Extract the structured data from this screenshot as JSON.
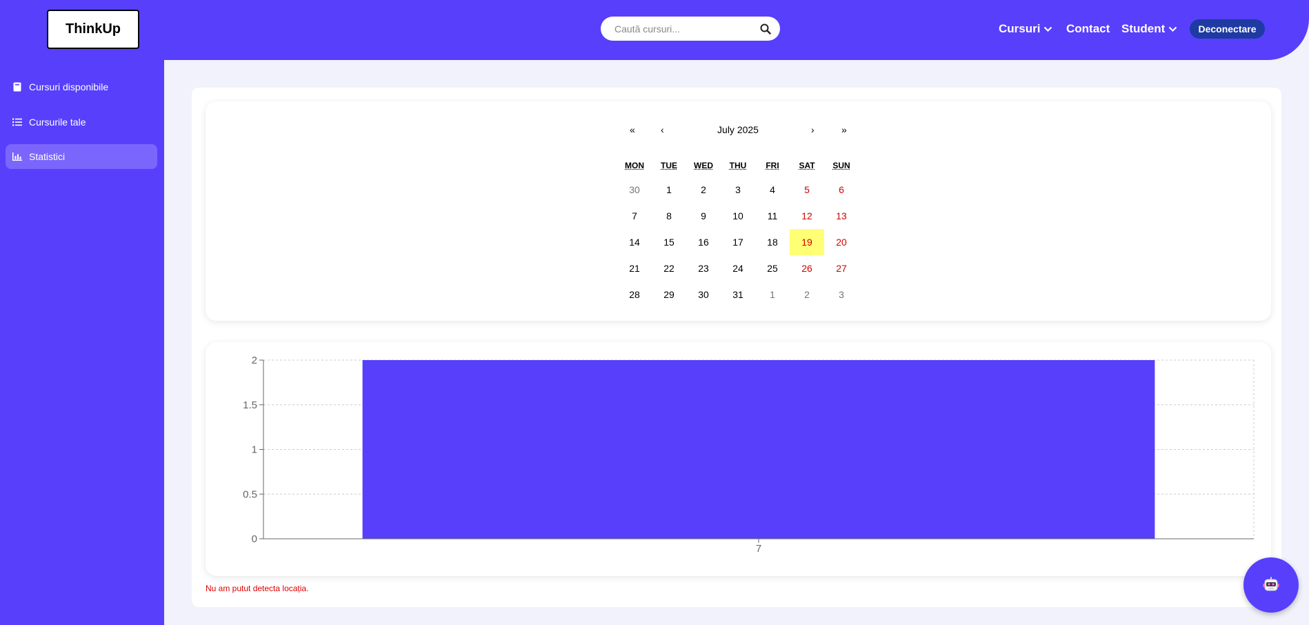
{
  "header": {
    "logo": "ThinkUp",
    "search_placeholder": "Caută cursuri...",
    "nav": {
      "courses": "Cursuri",
      "contact": "Contact",
      "student": "Student",
      "logout": "Deconectare"
    }
  },
  "sidebar": {
    "items": [
      {
        "label": "Cursuri disponibile",
        "icon": "book-icon"
      },
      {
        "label": "Cursurile tale",
        "icon": "list-icon"
      },
      {
        "label": "Statistici",
        "icon": "bar-chart-icon",
        "active": true
      }
    ]
  },
  "calendar": {
    "first_label": "«",
    "prev_label": "‹",
    "month_label": "July 2025",
    "next_label": "›",
    "last_label": "»",
    "weekdays": [
      "MON",
      "TUE",
      "WED",
      "THU",
      "FRI",
      "SAT",
      "SUN"
    ],
    "weeks": [
      [
        "30",
        "1",
        "2",
        "3",
        "4",
        "5",
        "6"
      ],
      [
        "7",
        "8",
        "9",
        "10",
        "11",
        "12",
        "13"
      ],
      [
        "14",
        "15",
        "16",
        "17",
        "18",
        "19",
        "20"
      ],
      [
        "21",
        "22",
        "23",
        "24",
        "25",
        "26",
        "27"
      ],
      [
        "28",
        "29",
        "30",
        "31",
        "1",
        "2",
        "3"
      ]
    ],
    "today": "19"
  },
  "chart_data": {
    "type": "bar",
    "categories": [
      "7"
    ],
    "values": [
      2
    ],
    "ylim": [
      0,
      2
    ],
    "yticks": [
      "0",
      "0.5",
      "1",
      "1.5",
      "2"
    ],
    "grid": true,
    "bar_color": "#573ffc",
    "title": "",
    "xlabel": "",
    "ylabel": ""
  },
  "status": {
    "error": "Nu am putut detecta locația."
  },
  "colors": {
    "primary": "#573ffc",
    "logout_button": "#1f3aa3",
    "today_highlight": "#ffff76",
    "weekend_text": "#d10000",
    "error_text": "#e00000"
  }
}
